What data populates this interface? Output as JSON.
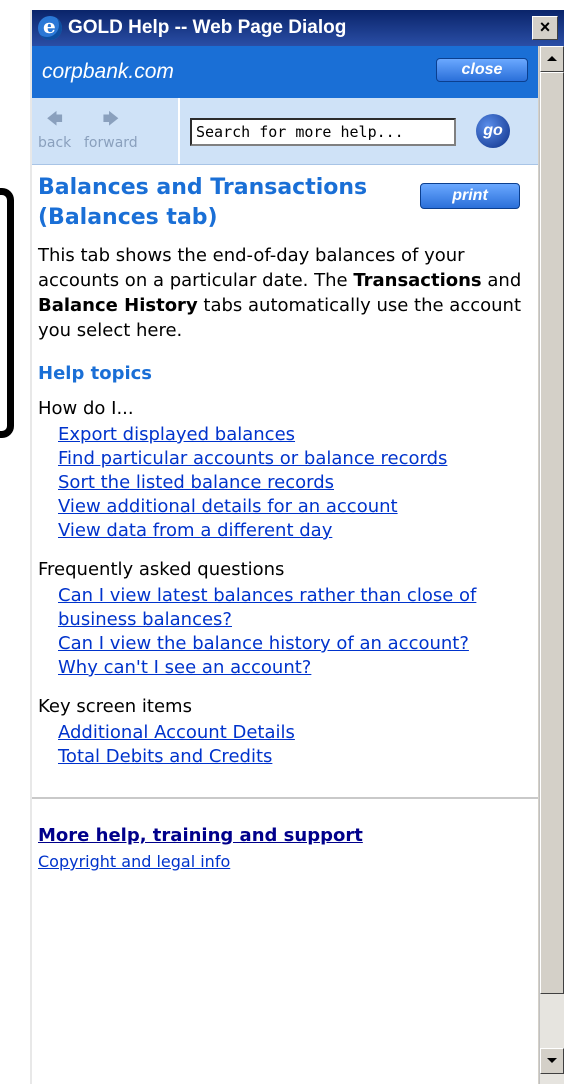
{
  "window": {
    "title": "GOLD Help -- Web Page Dialog",
    "close_glyph": "×"
  },
  "header": {
    "site": "corpbank.com",
    "close_label": "close"
  },
  "nav": {
    "back_label": "back",
    "forward_label": "forward",
    "search_value": "Search for more help...",
    "go_label": "go"
  },
  "page": {
    "title": "Balances and Transactions (Balances tab)",
    "print_label": "print",
    "intro_before": "This tab shows the end-of-day balances of your accounts on a particular date. The ",
    "intro_bold1": "Transactions",
    "intro_mid": " and ",
    "intro_bold2": "Balance History",
    "intro_after": " tabs automatically use the account you select here."
  },
  "help_topics": {
    "title": "Help topics",
    "groups": [
      {
        "label": "How do I...",
        "links": [
          "Export displayed balances",
          "Find particular accounts or balance records",
          "Sort the listed balance records",
          "View additional details for an account",
          "View data from a different day"
        ]
      },
      {
        "label": "Frequently asked questions",
        "links": [
          "Can I view latest balances rather than close of business balances?",
          "Can I view the balance history of an account?",
          "Why can't I see an account?"
        ]
      },
      {
        "label": "Key screen items",
        "links": [
          "Additional Account Details",
          "Total Debits and Credits"
        ]
      }
    ]
  },
  "footer": {
    "more_help": "More help, training and support",
    "copyright": "Copyright and legal info"
  },
  "colors": {
    "brand_blue": "#1a6fd6",
    "link_blue": "#0033cc"
  }
}
